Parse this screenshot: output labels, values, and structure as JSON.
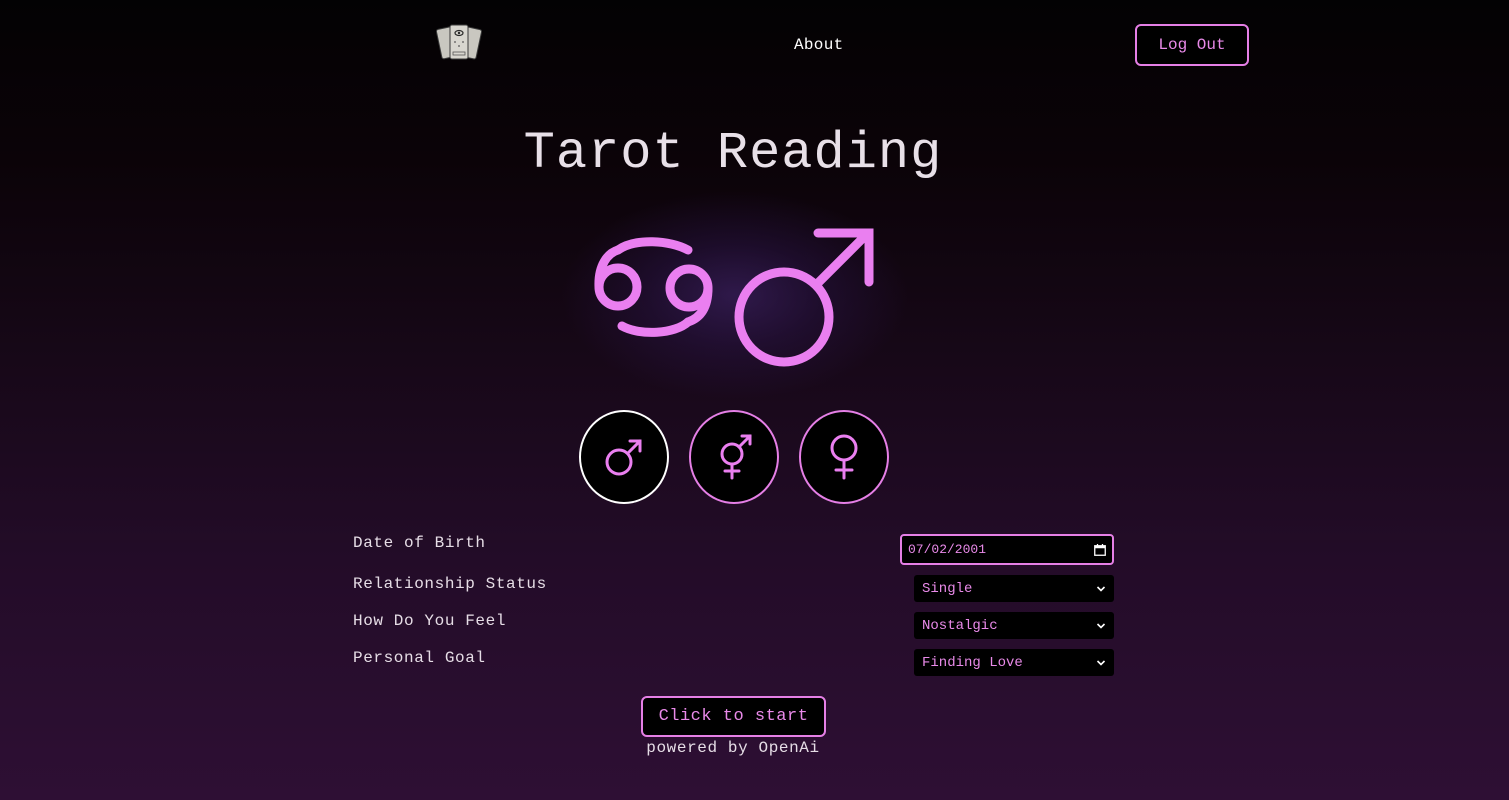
{
  "header": {
    "logo_icon": "tarot-cards-icon",
    "nav": {
      "about_label": "About"
    },
    "logout_label": "Log Out"
  },
  "main": {
    "title": "Tarot Reading",
    "hero": {
      "zodiac_icon": "cancer-zodiac-icon",
      "gender_icon": "male-symbol-icon",
      "glyphs": {
        "zodiac": "♋",
        "gender": "♂"
      }
    },
    "gender_options": [
      {
        "icon": "male-symbol-icon",
        "glyph": "♂",
        "selected": true
      },
      {
        "icon": "transgender-symbol-icon",
        "glyph": "⚧",
        "selected": false
      },
      {
        "icon": "female-symbol-icon",
        "glyph": "♀",
        "selected": false
      }
    ],
    "form": {
      "date_of_birth": {
        "label": "Date of Birth",
        "value": "07/02/2001"
      },
      "relationship_status": {
        "label": "Relationship Status",
        "selected": "Single"
      },
      "feeling": {
        "label": "How Do You Feel",
        "selected": "Nostalgic"
      },
      "personal_goal": {
        "label": "Personal Goal",
        "selected": "Finding Love"
      }
    },
    "start_label": "Click to start",
    "powered_by": "powered by OpenAi"
  },
  "colors": {
    "accent": "#e57fe6",
    "accent_text": "#e98ae9",
    "text": "#e6dde6",
    "background_top": "#030203",
    "background_bottom": "#2e0f34"
  }
}
